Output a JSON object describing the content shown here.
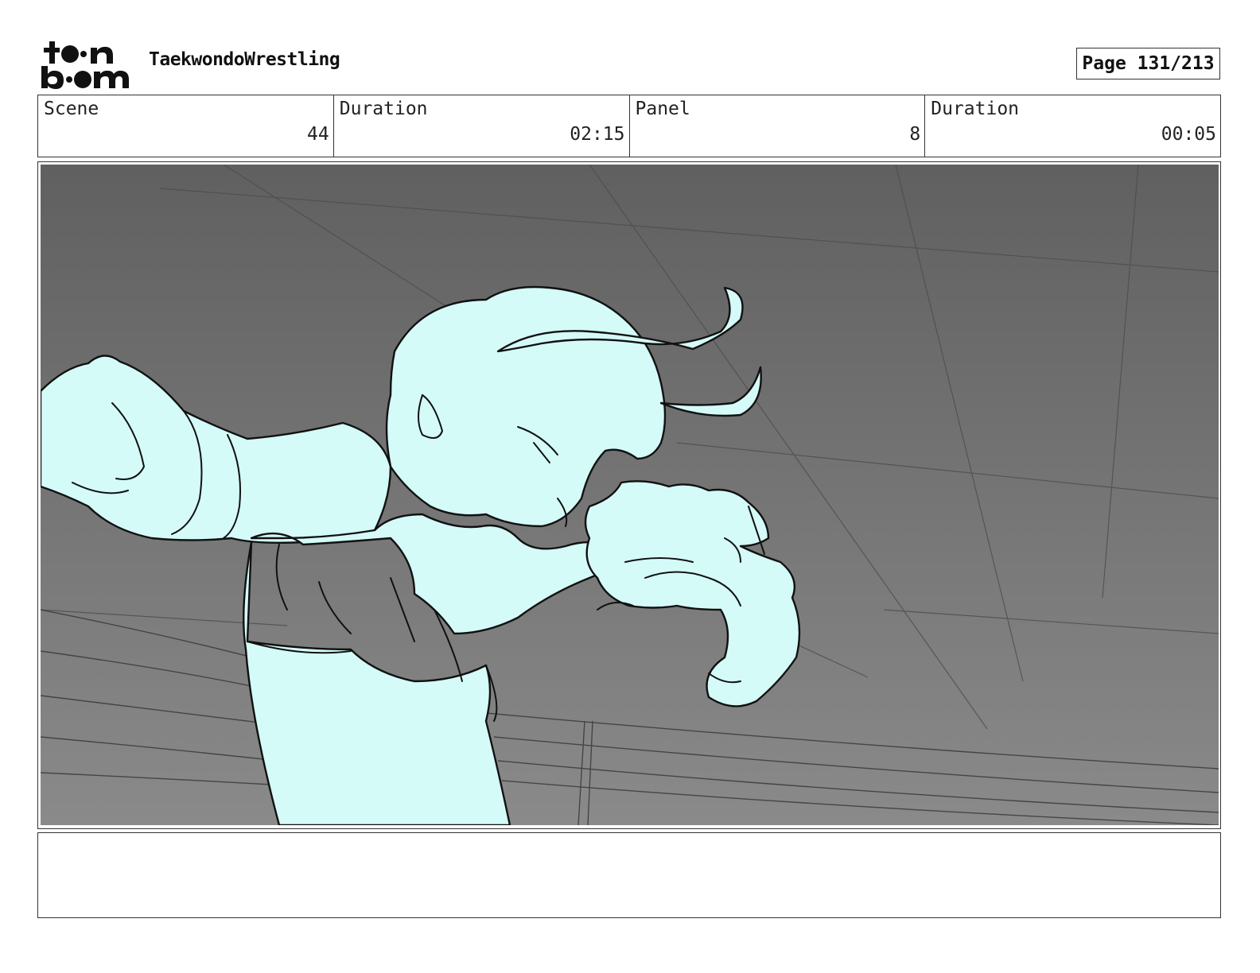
{
  "header": {
    "logo_top": "t•on",
    "logo_bottom": "b•om",
    "project_title": "TaekwondoWrestling",
    "page_label": "Page 131/213"
  },
  "info": {
    "scene_label": "Scene",
    "scene_value": "44",
    "scene_duration_label": "Duration",
    "scene_duration_value": "02:15",
    "panel_label": "Panel",
    "panel_value": "8",
    "panel_duration_label": "Duration",
    "panel_duration_value": "00:05"
  },
  "colors": {
    "background_gradient_top": "#5f5f5f",
    "background_gradient_bottom": "#8a8a8a",
    "character_fill": "#d4fbf8",
    "ink": "#111111"
  }
}
